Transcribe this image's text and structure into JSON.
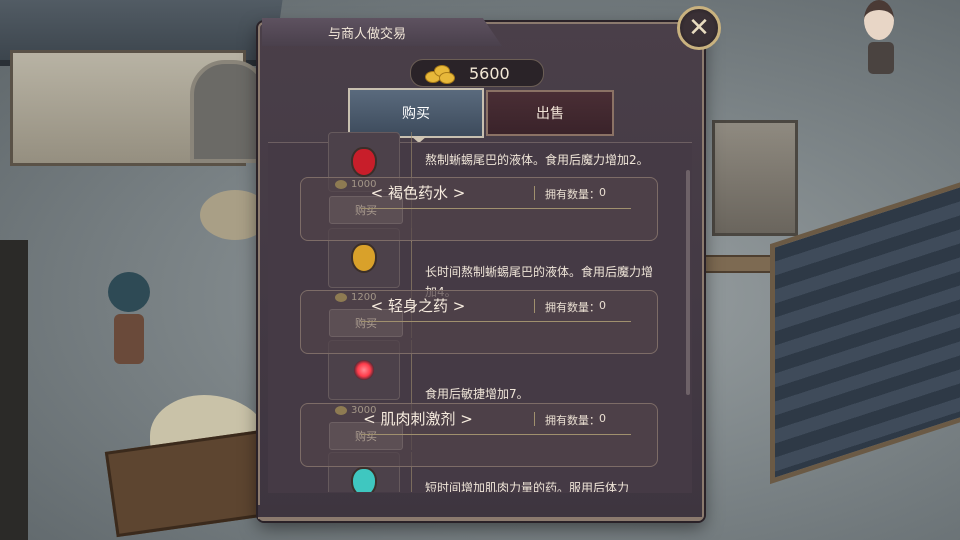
{
  "title": "与商人做交易",
  "close": {
    "glyph": "✕"
  },
  "gold": {
    "amount": "5600",
    "icon": "gold-coins-icon"
  },
  "tabs": {
    "buy": "购买",
    "sell": "出售"
  },
  "items": [
    {
      "name": "< 褐色药水 >",
      "description": "熬制蜥蜴尾巴的液体。食用后魔力增加2。",
      "price": "1000",
      "buy_label": "购买",
      "owned_label": "拥有数量：",
      "owned_value": "0",
      "icon": "red-potion-icon",
      "color": "#c81e2a"
    },
    {
      "name": "< 轻身之药 >",
      "description": "长时间熬制蜥蜴尾巴的液体。食用后魔力增加4。",
      "price": "1200",
      "buy_label": "购买",
      "owned_label": "拥有数量：",
      "owned_value": "0",
      "icon": "yellow-potion-icon",
      "color": "#d9a12a"
    },
    {
      "name": "< 肌肉刺激剂 >",
      "description": "食用后敏捷增加7。",
      "price": "3000",
      "buy_label": "购买",
      "owned_label": "拥有数量：",
      "owned_value": "0",
      "icon": "red-orb-icon",
      "color": "#ff4d5a"
    },
    {
      "description": "短时间增加肌肉力量的药。服用后体力",
      "icon": "teal-potion-icon",
      "color": "#3fc7c0"
    }
  ]
}
